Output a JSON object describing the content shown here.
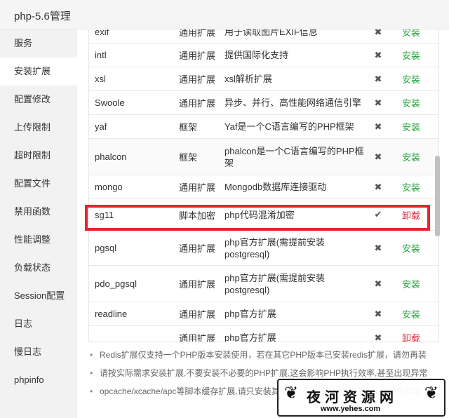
{
  "window": {
    "title": "php-5.6管理"
  },
  "sidebar": {
    "items": [
      {
        "label": "服务"
      },
      {
        "label": "安装扩展"
      },
      {
        "label": "配置修改"
      },
      {
        "label": "上传限制"
      },
      {
        "label": "超时限制"
      },
      {
        "label": "配置文件"
      },
      {
        "label": "禁用函数"
      },
      {
        "label": "性能调整"
      },
      {
        "label": "负载状态"
      },
      {
        "label": "Session配置"
      },
      {
        "label": "日志"
      },
      {
        "label": "慢日志"
      },
      {
        "label": "phpinfo"
      }
    ],
    "active_index": 1
  },
  "extensions": {
    "rows": [
      {
        "name": "exif",
        "type": "通用扩展",
        "desc": "用于读取图片EXIF信息",
        "installed": false,
        "action": "安装"
      },
      {
        "name": "intl",
        "type": "通用扩展",
        "desc": "提供国际化支持",
        "installed": false,
        "action": "安装"
      },
      {
        "name": "xsl",
        "type": "通用扩展",
        "desc": "xsl解析扩展",
        "installed": false,
        "action": "安装"
      },
      {
        "name": "Swoole",
        "type": "通用扩展",
        "desc": "异步、并行、高性能网络通信引擎",
        "installed": false,
        "action": "安装"
      },
      {
        "name": "yaf",
        "type": "框架",
        "desc": "Yaf是一个C语言编写的PHP框架",
        "installed": false,
        "action": "安装"
      },
      {
        "name": "phalcon",
        "type": "框架",
        "desc": "phalcon是一个C语言编写的PHP框架",
        "installed": false,
        "action": "安装"
      },
      {
        "name": "mongo",
        "type": "通用扩展",
        "desc": "Mongodb数据库连接驱动",
        "installed": false,
        "action": "安装"
      },
      {
        "name": "sg11",
        "type": "脚本加密",
        "desc": "php代码混淆加密",
        "installed": true,
        "action": "卸载"
      },
      {
        "name": "pgsql",
        "type": "通用扩展",
        "desc": "php官方扩展(需提前安装postgresql)",
        "installed": false,
        "action": "安装"
      },
      {
        "name": "pdo_pgsql",
        "type": "通用扩展",
        "desc": "php官方扩展(需提前安装postgresql)",
        "installed": false,
        "action": "安装"
      },
      {
        "name": "readline",
        "type": "通用扩展",
        "desc": "php官方扩展",
        "installed": false,
        "action": "安装"
      },
      {
        "name": "",
        "type": "通用扩展",
        "desc": "php官方扩展",
        "installed": false,
        "action": "卸载"
      }
    ]
  },
  "icons": {
    "installed": "check-icon",
    "not_installed": "x-icon"
  },
  "colors": {
    "install": "#20a53a",
    "uninstall": "#e0283c",
    "highlight": "#e8232b"
  },
  "notes": [
    "Redis扩展仅支持一个PHP版本安装使用，若在其它PHP版本已安装redis扩展，请勿再装",
    "请按实际需求安装扩展,不要安装不必要的PHP扩展,这会影响PHP执行效率,甚至出现异常",
    "opcache/xcache/apc等脚本缓存扩展,请只安装其中1个,否则可能导致您的站点程序异常"
  ],
  "watermark": {
    "main": "夜河资源网",
    "url": "www.yehes.com"
  }
}
